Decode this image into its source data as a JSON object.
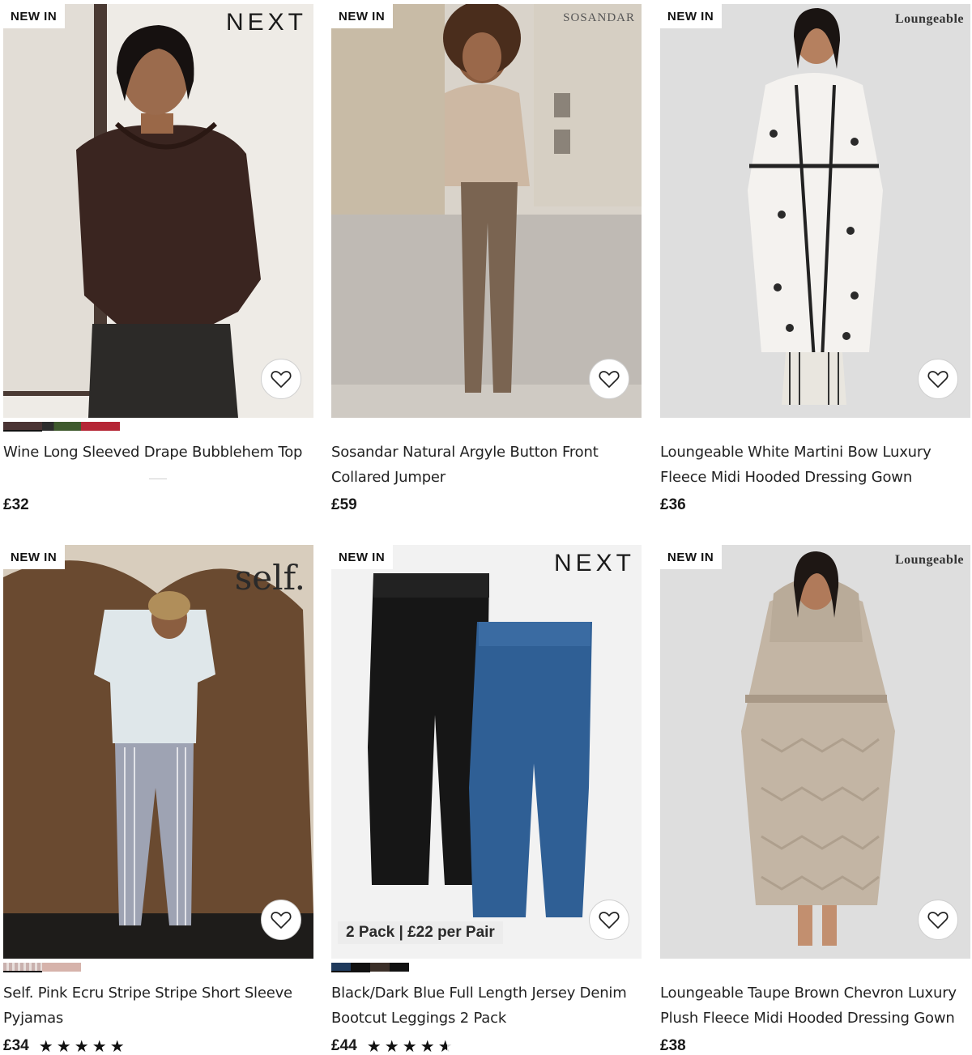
{
  "products": [
    {
      "badge": "NEW IN",
      "brand": "NEXT",
      "title": "Wine Long Sleeved Drape Bubblehem Top",
      "price": "£32",
      "swatches": [
        "#4a3434",
        "#2d2d2d",
        "#3f5a2e",
        "#b52636"
      ],
      "rating": null,
      "promo": null
    },
    {
      "badge": "NEW IN",
      "brand": "SOSANDAR",
      "title": "Sosandar Natural Argyle Button Front Collared Jumper",
      "price": "£59",
      "swatches": [],
      "rating": null,
      "promo": null
    },
    {
      "badge": "NEW IN",
      "brand": "Loungeable",
      "title": "Loungeable White Martini Bow Luxury Fleece Midi Hooded Dressing Gown",
      "price": "£36",
      "swatches": [],
      "rating": null,
      "promo": null
    },
    {
      "badge": "NEW IN",
      "brand": "self.",
      "title": "Self. Pink Ecru Stripe Stripe Short Sleeve Pyjamas",
      "price": "£34",
      "swatches": [
        "#c9b1ae",
        "#d6b3ab"
      ],
      "rating": 5,
      "promo": null
    },
    {
      "badge": "NEW IN",
      "brand": "NEXT",
      "title": "Black/Dark Blue Full Length Jersey Denim Bootcut Leggings 2 Pack",
      "price": "£44",
      "swatches": [
        "#1f3a5c",
        "#3b2f28"
      ],
      "rating": 4.5,
      "promo": "2 Pack | £22 per Pair"
    },
    {
      "badge": "NEW IN",
      "brand": "Loungeable",
      "title": "Loungeable Taupe Brown Chevron Luxury Plush Fleece Midi Hooded Dressing Gown",
      "price": "£38",
      "swatches": [],
      "rating": null,
      "promo": null
    }
  ],
  "icons": {
    "favourite": "heart-outline-icon",
    "star": "star-icon"
  },
  "colors": {
    "text": "#1f1f1f",
    "badge_bg": "#ffffff",
    "star": "#111111"
  }
}
